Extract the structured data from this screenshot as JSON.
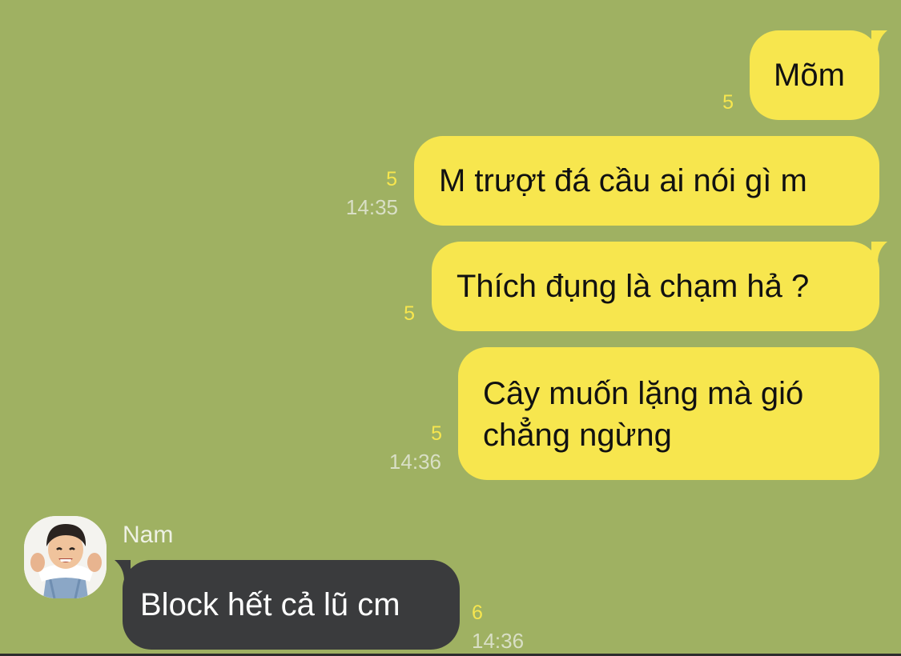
{
  "messages": [
    {
      "id": "m1",
      "direction": "outgoing",
      "text": "Mõm",
      "read_count": "5",
      "time": ""
    },
    {
      "id": "m2",
      "direction": "outgoing",
      "text": "M trượt đá cầu ai nói gì m",
      "read_count": "5",
      "time": "14:35"
    },
    {
      "id": "m3",
      "direction": "outgoing",
      "text": "Thích đụng là chạm hả ?",
      "read_count": "5",
      "time": ""
    },
    {
      "id": "m4",
      "direction": "outgoing",
      "lines": [
        "Cây muốn lặng mà gió",
        "chẳng ngừng"
      ],
      "read_count": "5",
      "time": "14:36"
    },
    {
      "id": "m5",
      "direction": "incoming",
      "sender": "Nam",
      "avatar_icon": "child-avatar-icon",
      "text": "Block hết cả lũ cm",
      "read_count": "6",
      "time": "14:36"
    }
  ],
  "colors": {
    "background": "#9fb162",
    "outgoing_bubble": "#f7e64e",
    "incoming_bubble": "#3a3b3d",
    "read_count": "#f7e64e",
    "time": "#d9dfc6"
  }
}
